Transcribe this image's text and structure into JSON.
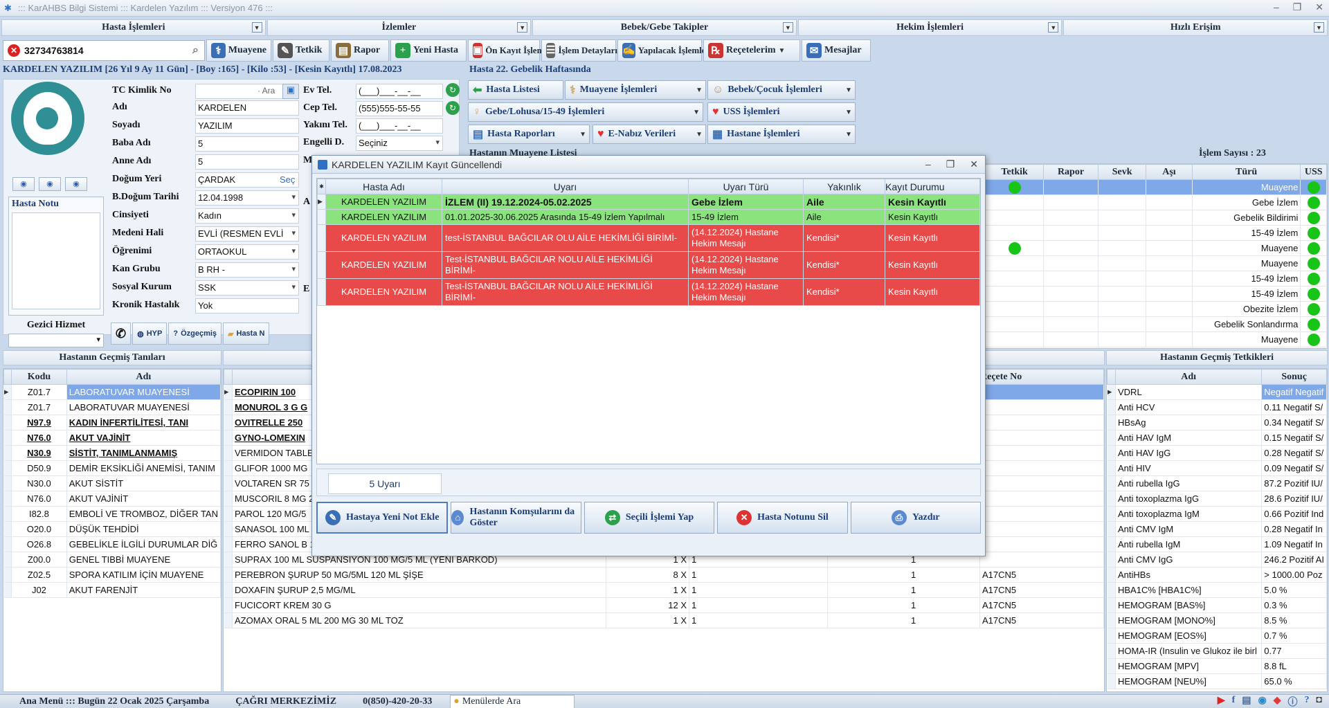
{
  "app": {
    "title": "::: KarAHBS  Bilgi Sistemi ::: Kardelen Yazılım ::: Versiyon 476 :::"
  },
  "menus": [
    "Hasta İşlemleri",
    "İzlemler",
    "Bebek/Gebe Takipler",
    "Hekim İşlemleri",
    "Hızlı Erişim"
  ],
  "search": {
    "value": "32734763814"
  },
  "toolbar": [
    {
      "label": "Muayene",
      "icon": "stethoscope-icon",
      "color": "#3a6fb7"
    },
    {
      "label": "Tetkik",
      "icon": "microscope-icon",
      "color": "#555"
    },
    {
      "label": "Rapor",
      "icon": "clipboard-icon",
      "color": "#8a6d3b"
    },
    {
      "label": "Yeni Hasta",
      "icon": "add-user-icon",
      "color": "#2aa14a"
    },
    {
      "label": "Ön Kayıt İşlemleri",
      "icon": "monitor-icon",
      "color": "#c33"
    },
    {
      "label": "İşlem Detayları",
      "icon": "list-icon",
      "color": "#666"
    },
    {
      "label": "Yapılacak İşlemlerim",
      "icon": "pen-icon",
      "color": "#3a6fb7"
    },
    {
      "label": "Reçetelerim",
      "icon": "prescription-icon",
      "color": "#c33"
    },
    {
      "label": "Mesajlar",
      "icon": "mail-icon",
      "color": "#3a6fb7"
    }
  ],
  "patient_bar": "KARDELEN YAZILIM  [26 Yıl  9 Ay 11 Gün] - [Boy :165] - [Kilo :53] - [Kesin Kayıtlı]  17.08.2023",
  "gebelik": "Hasta 22. Gebelik Haftasında",
  "form": {
    "tc_label": "TC Kimlik No",
    "tc_btn": "· Ara",
    "ad_label": "Adı",
    "ad": "KARDELEN",
    "soyad_label": "Soyadı",
    "soyad": "YAZILIM",
    "baba_label": "Baba Adı",
    "baba": "5",
    "anne_label": "Anne Adı",
    "anne": "5",
    "dogumyeri_label": "Doğum Yeri",
    "dogumyeri": "ÇARDAK",
    "sec": "Seç",
    "dt_label": "B.Doğum Tarihi",
    "dt": "12.04.1998",
    "cins_label": "Cinsiyeti",
    "cins": "Kadın",
    "medeni_label": "Medeni Hali",
    "medeni": "EVLİ (RESMEN EVLİ",
    "ogrenim_label": "Öğrenimi",
    "ogrenim": "ORTAOKUL",
    "kan_label": "Kan Grubu",
    "kan": "B RH -",
    "kurum_label": "Sosyal Kurum",
    "kurum": "SSK",
    "kronik_label": "Kronik Hastalık",
    "kronik": "Yok",
    "evtel_label": "Ev Tel.",
    "evtel": "(___)___-__-__",
    "ceptel_label": "Cep Tel.",
    "ceptel": "(555)555-55-55",
    "yakintel_label": "Yakını Tel.",
    "yakintel": "(___)___-__-__",
    "engelli_label": "Engelli D.",
    "engelli": "Seçiniz",
    "m_label": "M",
    "a_label": "A",
    "e_label": "E"
  },
  "note": {
    "title": "Hasta Notu"
  },
  "gezici": {
    "title": "Gezici Hizmet"
  },
  "small_btns": [
    "HYP",
    "Özgeçmiş",
    "Hasta N"
  ],
  "right_btns": [
    {
      "label": "Hasta Listesi"
    },
    {
      "label": "Muayene İşlemleri"
    },
    {
      "label": "Bebek/Çocuk İşlemleri"
    },
    {
      "label": "Gebe/Lohusa/15-49 İşlemleri"
    },
    {
      "label": "USS İşlemleri"
    },
    {
      "label": "Hasta Raporları"
    },
    {
      "label": "E-Nabız Verileri"
    },
    {
      "label": "Hastane İşlemleri"
    }
  ],
  "muayene_list": {
    "title_partial": "Hastanın Muayene Listesi",
    "count": "İşlem Sayısı : 23",
    "cols": [
      "Tetkik",
      "Rapor",
      "Sevk",
      "Aşı",
      "Türü",
      "USS"
    ],
    "rows": [
      {
        "tur": "Muayene",
        "tetkik": true,
        "sel": true
      },
      {
        "tur": "Gebe İzlem",
        "tetkik": false
      },
      {
        "tur": "Gebelik Bildirimi",
        "tetkik": false
      },
      {
        "tur": "15-49 İzlem",
        "tetkik": false
      },
      {
        "tur": "Muayene",
        "tetkik": true
      },
      {
        "tur": "Muayene",
        "tetkik": false
      },
      {
        "tur": "15-49 İzlem",
        "tetkik": false
      },
      {
        "tur": "15-49 İzlem",
        "tetkik": false
      },
      {
        "tur": "Obezite İzlem",
        "tetkik": false
      },
      {
        "tur": "Gebelik Sonlandırma",
        "tetkik": false
      },
      {
        "tur": "Muayene",
        "tetkik": false
      }
    ]
  },
  "gecmis_tani": {
    "title": "Hastanın Geçmiş Tanıları",
    "cols": [
      "Kodu",
      "Adı"
    ],
    "rows": [
      {
        "k": "Z01.7",
        "a": "LABORATUVAR MUAYENESİ",
        "b": false,
        "sel": true
      },
      {
        "k": "Z01.7",
        "a": "LABORATUVAR MUAYENESİ",
        "b": false
      },
      {
        "k": "N97.9",
        "a": "KADIN İNFERTİLİTESİ, TANI",
        "b": true
      },
      {
        "k": "N76.0",
        "a": "AKUT VAJİNİT",
        "b": true
      },
      {
        "k": "N30.9",
        "a": "SİSTİT, TANIMLANMAMIŞ",
        "b": true
      },
      {
        "k": "D50.9",
        "a": "DEMİR EKSİKLİĞİ ANEMİSİ, TANIM",
        "b": false
      },
      {
        "k": "N30.0",
        "a": "AKUT SİSTİT",
        "b": false
      },
      {
        "k": "N76.0",
        "a": "AKUT VAJİNİT",
        "b": false
      },
      {
        "k": "I82.8",
        "a": "EMBOLİ VE TROMBOZ, DİĞER TAN",
        "b": false
      },
      {
        "k": "O20.0",
        "a": "DÜŞÜK TEHDİDİ",
        "b": false
      },
      {
        "k": "O26.8",
        "a": "GEBELİKLE İLGİLİ DURUMLAR DİĞ",
        "b": false
      },
      {
        "k": "Z00.0",
        "a": "GENEL TIBBİ MUAYENE",
        "b": false
      },
      {
        "k": "Z02.5",
        "a": "SPORA KATILIM İÇİN MUAYENE",
        "b": false
      },
      {
        "k": "J02",
        "a": "AKUT FARENJİT",
        "b": false
      }
    ]
  },
  "ilaclar": {
    "recete_col": "Reçete No",
    "rows": [
      {
        "n": "ECOPIRIN 100",
        "b": true,
        "sel": true,
        "q": "",
        "d": "",
        "p": "",
        "r": ""
      },
      {
        "n": "MONUROL 3 G G",
        "b": true,
        "q": "",
        "d": "",
        "p": "",
        "r": ""
      },
      {
        "n": "OVITRELLE 250",
        "b": true,
        "q": "",
        "d": "",
        "p": "",
        "r": ""
      },
      {
        "n": "GYNO-LOMEXIN",
        "b": true,
        "q": "",
        "d": "",
        "p": "",
        "r": ""
      },
      {
        "n": "VERMIDON TABLE",
        "b": false,
        "q": "",
        "d": "",
        "p": "",
        "r": ""
      },
      {
        "n": "GLIFOR 1000 MG",
        "b": false,
        "q": "",
        "d": "",
        "p": "",
        "r": ""
      },
      {
        "n": "VOLTAREN SR 75",
        "b": false,
        "q": "",
        "d": "",
        "p": "",
        "r": ""
      },
      {
        "n": "MUSCORIL 8 MG 2",
        "b": false,
        "q": "",
        "d": "",
        "p": "",
        "r": ""
      },
      {
        "n": "PAROL 120 MG/5",
        "b": false,
        "q": "",
        "d": "",
        "p": "",
        "r": ""
      },
      {
        "n": "SANASOL 100 ML",
        "b": false,
        "q": "",
        "d": "",
        "p": "",
        "r": ""
      },
      {
        "n": "FERRO SANOL B 1",
        "b": false,
        "q": "",
        "d": "",
        "p": "",
        "r": ""
      },
      {
        "n": "SUPRAX 100 ML SUSPANSIYON 100 MG/5 ML (YENİ BARKOD)",
        "b": false,
        "q": "1 X",
        "d": "1",
        "p": "1",
        "r": ""
      },
      {
        "n": "PEREBRON ŞURUP 50 MG/5ML 120 ML ŞİŞE",
        "b": false,
        "q": "8 X",
        "d": "1",
        "p": "1",
        "r": "A17CN5"
      },
      {
        "n": "DOXAFIN ŞURUP 2,5 MG/ML",
        "b": false,
        "q": "1 X",
        "d": "1",
        "p": "1",
        "r": "A17CN5"
      },
      {
        "n": "FUCICORT KREM 30 G",
        "b": false,
        "q": "12 X",
        "d": "1",
        "p": "1",
        "r": "A17CN5"
      },
      {
        "n": "AZOMAX ORAL 5 ML 200 MG 30 ML TOZ",
        "b": false,
        "q": "1 X",
        "d": "1",
        "p": "1",
        "r": "A17CN5"
      }
    ]
  },
  "tetkikler": {
    "title": "Hastanın Geçmiş Tetkikleri",
    "cols": [
      "Adı",
      "Sonuç"
    ],
    "rows": [
      {
        "a": "VDRL",
        "s": "Negatif Negatif",
        "sel": true
      },
      {
        "a": "Anti HCV",
        "s": "0.11 Negatif S/"
      },
      {
        "a": "HBsAg",
        "s": "0.34 Negatif S/"
      },
      {
        "a": "Anti HAV IgM",
        "s": "0.15 Negatif S/"
      },
      {
        "a": "Anti HAV IgG",
        "s": "0.28 Negatif S/"
      },
      {
        "a": "Anti HIV",
        "s": "0.09 Negatif S/"
      },
      {
        "a": "Anti rubella IgG",
        "s": "87.2 Pozitif IU/"
      },
      {
        "a": "Anti toxoplazma IgG",
        "s": "28.6 Pozitif IU/"
      },
      {
        "a": "Anti toxoplazma IgM",
        "s": "0.66 Pozitif Ind"
      },
      {
        "a": "Anti CMV IgM",
        "s": "0.28 Negatif In"
      },
      {
        "a": "Anti rubella IgM",
        "s": "1.09 Negatif In"
      },
      {
        "a": "Anti CMV IgG",
        "s": "246.2 Pozitif AI"
      },
      {
        "a": "AntiHBs",
        "s": "> 1000.00 Poz"
      },
      {
        "a": "HBA1C% [HBA1C%]",
        "s": "5.0 %"
      },
      {
        "a": "HEMOGRAM [BAS%]",
        "s": "0.3 %"
      },
      {
        "a": "HEMOGRAM [MONO%]",
        "s": "8.5 %"
      },
      {
        "a": "HEMOGRAM [EOS%]",
        "s": "0.7 %"
      },
      {
        "a": "HOMA-IR (Insulin ve Glukoz ile birl",
        "s": "0.77"
      },
      {
        "a": "HEMOGRAM [MPV]",
        "s": "8.8 fL"
      },
      {
        "a": "HEMOGRAM [NEU%]",
        "s": "65.0 %"
      }
    ]
  },
  "dialog": {
    "title": "KARDELEN YAZILIM Kayıt Güncellendi",
    "cols": [
      "Hasta Adı",
      "Uyarı",
      "Uyarı Türü",
      "Yakınlık",
      "Kayıt Durumu"
    ],
    "rows": [
      {
        "t": "g",
        "hasta": "KARDELEN YAZILIM",
        "uyari": "İZLEM (II) 19.12.2024-05.02.2025",
        "tur": "Gebe İzlem",
        "yak": "Aile",
        "durum": "Kesin Kayıtlı",
        "bold": true
      },
      {
        "t": "g",
        "hasta": "KARDELEN YAZILIM",
        "uyari": "01.01.2025-30.06.2025 Arasında 15-49 İzlem Yapılmalı",
        "tur": "15-49 İzlem",
        "yak": "Aile",
        "durum": "Kesin Kayıtlı",
        "bold": false
      },
      {
        "t": "r",
        "hasta": "KARDELEN YAZILIM",
        "uyari": "test-İSTANBUL BAĞCILAR              OLU AİLE HEKİMLİĞİ BİRİMİ-",
        "tur": "(14.12.2024) Hastane Hekim Mesajı",
        "yak": "Kendisi*",
        "durum": "Kesin Kayıtlı"
      },
      {
        "t": "r",
        "hasta": "KARDELEN YAZILIM",
        "uyari": "Test-İSTANBUL BAĞCILAR              NOLU AİLE HEKİMLİĞİ BİRİMİ-",
        "tur": "(14.12.2024) Hastane Hekim Mesajı",
        "yak": "Kendisi*",
        "durum": "Kesin Kayıtlı"
      },
      {
        "t": "r",
        "hasta": "KARDELEN YAZILIM",
        "uyari": "Test-İSTANBUL BAĞCILAR              NOLU AİLE HEKİMLİĞİ BİRİMİ-",
        "tur": "(14.12.2024) Hastane Hekim Mesajı",
        "yak": "Kendisi*",
        "durum": "Kesin Kayıtlı"
      }
    ],
    "count": "5 Uyarı",
    "buttons": [
      {
        "label": "Hastaya Yeni Not Ekle",
        "color": "#3a6fb7"
      },
      {
        "label": "Hastanın Komşularını da Göster",
        "color": "#5c8ad1"
      },
      {
        "label": "Seçili İşlemi Yap",
        "color": "#2aa14a"
      },
      {
        "label": "Hasta Notunu Sil",
        "color": "#d33"
      },
      {
        "label": "Yazdır",
        "color": "#5c8ad1"
      }
    ]
  },
  "status": {
    "menu": "Ana Menü ::: Bugün 22 Ocak 2025 Çarşamba",
    "cagri": "ÇAĞRI MERKEZİMİZ",
    "tel": "0(850)-420-20-33",
    "ara": "Menülerde Ara"
  }
}
